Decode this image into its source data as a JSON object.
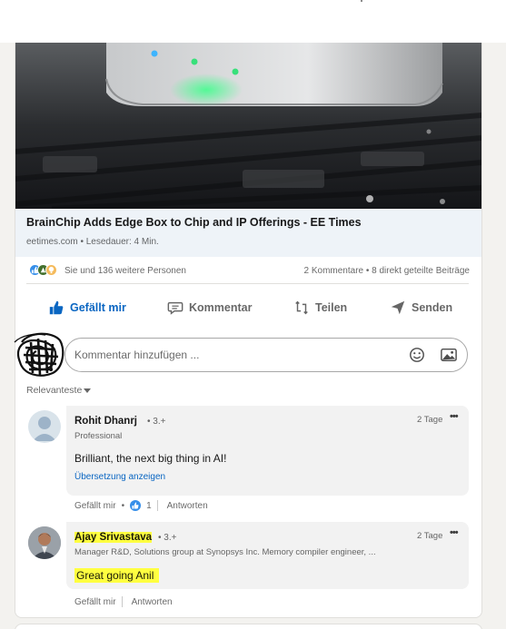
{
  "article": {
    "title": "BrainChip Adds Edge Box to Chip and IP Offerings - EE Times",
    "source": "eetimes.com • Lesedauer: 4 Min."
  },
  "social": {
    "reactions_text": "Sie und 136 weitere Personen",
    "comments_shares": "2 Kommentare • 8 direkt geteilte Beiträge"
  },
  "actions": {
    "like": "Gefällt mir",
    "comment": "Kommentar",
    "share": "Teilen",
    "send": "Senden"
  },
  "comment_input": {
    "placeholder": "Kommentar hinzufügen ..."
  },
  "sort_label": "Relevanteste",
  "comments": [
    {
      "name": "Rohit Dhanrj",
      "degree": "• 3.+",
      "headline": "Professional",
      "time": "2 Tage",
      "text": "Brilliant, the next big thing in AI!",
      "translate": "Übersetzung anzeigen",
      "like_label": "Gefällt mir",
      "like_count": "1",
      "reply_label": "Antworten"
    },
    {
      "name": "Ajay Srivastava",
      "degree": "• 3.+",
      "headline": "Manager R&D, Solutions group at Synopsys Inc. Memory compiler engineer, ...",
      "time": "2 Tage",
      "text": "Great going Anil",
      "like_label": "Gefällt mir",
      "reply_label": "Antworten"
    }
  ],
  "colors": {
    "accent": "#0a66c2",
    "highlight": "#ffff40"
  }
}
